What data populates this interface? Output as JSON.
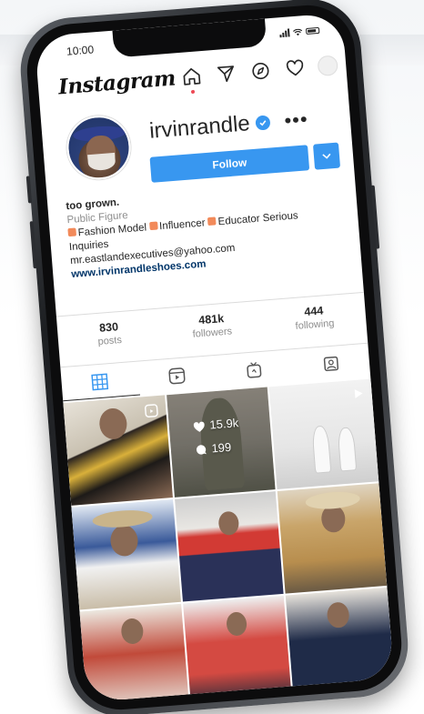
{
  "status_bar": {
    "time": "10:00"
  },
  "header": {
    "logo": "Instagram",
    "icons": [
      "home-icon",
      "direct-icon",
      "explore-icon",
      "heart-icon",
      "profile-avatar"
    ]
  },
  "profile": {
    "username": "irvinrandle",
    "verified": true,
    "more_label": "•••",
    "follow_label": "Follow",
    "bio": {
      "name": "too grown.",
      "category": "Public Figure",
      "line1_a": "Fashion Model",
      "line1_b": "Influencer",
      "line1_c": "Educator Serious",
      "line2": "Inquiries",
      "email": "mr.eastlandexecutives@yahoo.com",
      "website": "www.irvinrandleshoes.com"
    }
  },
  "stats": [
    {
      "number": "830",
      "label": "posts"
    },
    {
      "number": "481k",
      "label": "followers"
    },
    {
      "number": "444",
      "label": "following"
    }
  ],
  "tabs": [
    "grid-icon",
    "reels-icon",
    "igtv-icon",
    "tagged-icon"
  ],
  "grid": {
    "hover_post": {
      "likes": "15.9k",
      "comments": "199"
    }
  },
  "colors": {
    "accent": "#3897f0",
    "notification": "#ed4956"
  }
}
